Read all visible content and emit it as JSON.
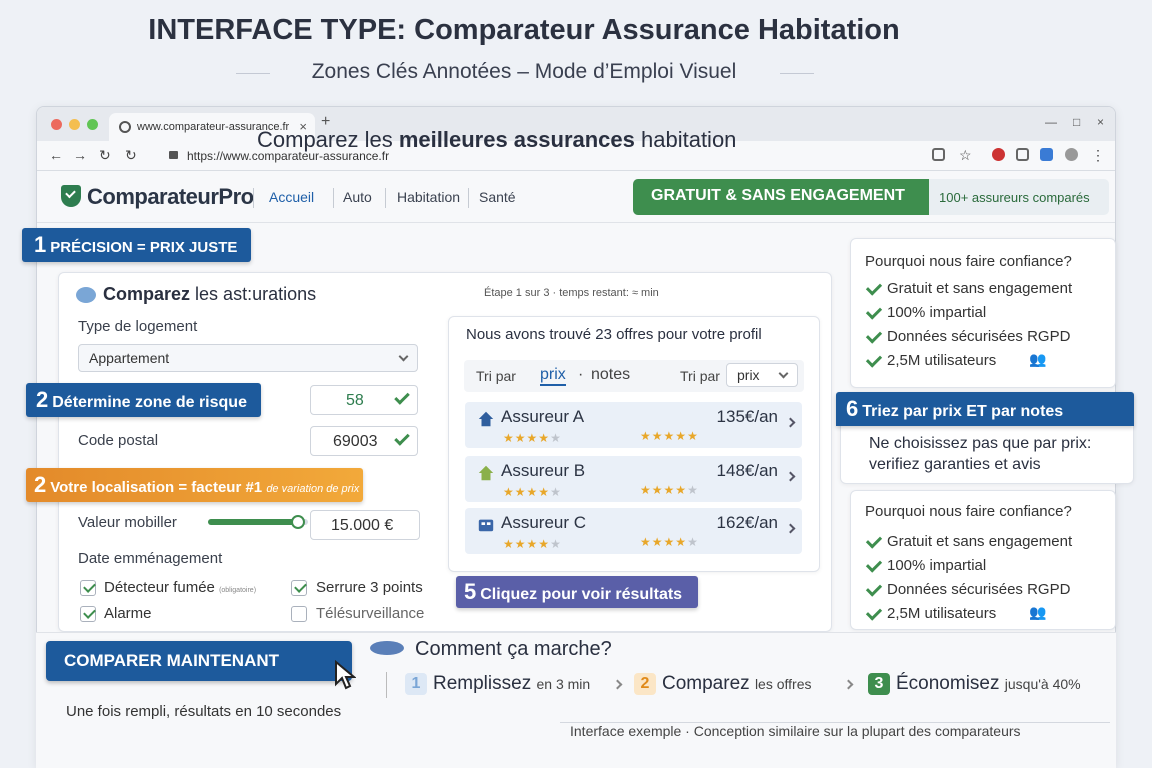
{
  "heading": {
    "title": "INTERFACE TYPE: Comparateur Assurance Habitation",
    "subtitle": "Zones Clés Annotées – Mode d’Emploi Visuel"
  },
  "browser": {
    "tab_title": "www.comparateur-assurance.fr",
    "url": "https://www.comparateur-assurance.fr"
  },
  "site": {
    "logo": "ComparateurPro",
    "nav": [
      "Accueil",
      "Auto",
      "Habitation",
      "Santé"
    ],
    "badge": "GRATUIT & SANS ENGAGEMENT",
    "insurers": "100+ assureurs comparés"
  },
  "headline": {
    "pre": "Comparez les ",
    "bold": "meilleures assurances",
    "post": " habitation"
  },
  "callouts": {
    "c1_num": "1",
    "c1_text": "PRÉCISION = PRIX JUSTE",
    "c2a_num": "2",
    "c2a_text": "Détermine zone de risque",
    "c2b_num": "2",
    "c2b_text": "Votre localisation = facteur #1",
    "c2b_small": "de variation de prix",
    "c5_num": "5",
    "c5_text": "Cliquez pour voir résultats",
    "c6_num": "6",
    "c6_text": "Triez par prix ET par notes",
    "c6_note": "Ne choisissez pas que par prix: verifiez garanties et avis"
  },
  "form": {
    "title_bold": "Comparez",
    "title_rest": "les ast:urations",
    "step": "Étape 1 sur 3 · temps restant: ≈ min",
    "type_label": "Type de logement",
    "type_value": "Appartement",
    "zone_value": "58",
    "postal_label": "Code postal",
    "postal_value": "69003",
    "valeur_label": "Valeur mobiller",
    "valeur_value": "15.000 €",
    "valeur_level": 0.9,
    "date_label": "Date emménagement",
    "options": [
      {
        "label": "Détecteur fumée",
        "small": "(obligatoire)",
        "checked": true
      },
      {
        "label": "Serrure 3 points",
        "small": "",
        "checked": true
      },
      {
        "label": "Alarme",
        "small": "",
        "checked": true
      },
      {
        "label": "Télésurveillance",
        "small": "",
        "checked": false
      }
    ],
    "cta": "COMPARER MAINTENANT",
    "cta_note": "Une fois rempli, résultats en 10 secondes"
  },
  "results": {
    "title": "Nous avons trouvé 23 offres pour votre profil",
    "sort_by": "Tri par",
    "sort_price": "prix",
    "sort_notes": "notes",
    "sort_by2": "Tri par",
    "sort_select": "prix",
    "offers": [
      {
        "name": "Assureur A",
        "price": "135€/an",
        "rating": 4,
        "price_rating": 5,
        "icon": "house-icon"
      },
      {
        "name": "Assureur B",
        "price": "148€/an",
        "rating": 4,
        "price_rating": 4,
        "icon": "house-green-icon"
      },
      {
        "name": "Assureur C",
        "price": "162€/an",
        "rating": 4,
        "price_rating": 4,
        "icon": "building-icon"
      }
    ]
  },
  "trust": {
    "title": "Pourquoi nous faire confiance?",
    "items": [
      "Gratuit et sans engagement",
      "100% impartial",
      "Données sécurisées RGPD",
      "2,5M utilisateurs"
    ]
  },
  "how": {
    "title": "Comment ça marche?",
    "steps": [
      {
        "num": "1",
        "bold": "Remplissez",
        "small": "en 3 min",
        "color": "#7aa6d6"
      },
      {
        "num": "2",
        "bold": "Comparez",
        "small": "les offres",
        "color": "#f0a63a"
      },
      {
        "num": "3",
        "bold": "Économisez",
        "small": "jusqu'à 40%",
        "color": "#3e8e4e"
      }
    ]
  },
  "footer_note": "Interface exemple · Conception similaire sur la plupart des comparateurs",
  "colors": {
    "accent": "#1d5a9c",
    "green": "#3e8e4e",
    "orange": "#f0a63a",
    "purple": "#5a5fa8"
  }
}
